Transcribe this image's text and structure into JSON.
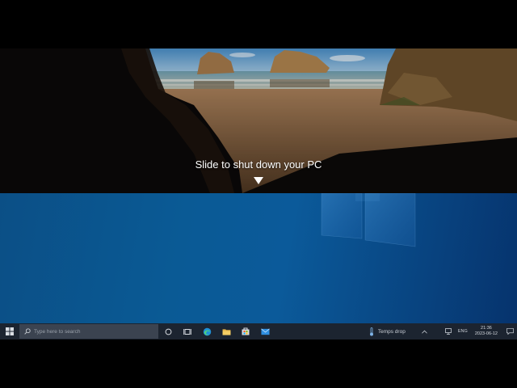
{
  "lock_screen": {
    "prompt": "Slide to shut down your PC"
  },
  "taskbar": {
    "search_placeholder": "Type here to search",
    "weather_text": "Temps drop",
    "language": "ENG",
    "clock_time": "21:36",
    "clock_date": "2023-06-12",
    "pinned": [
      {
        "name": "cortana-icon"
      },
      {
        "name": "task-view-icon"
      },
      {
        "name": "edge-icon"
      },
      {
        "name": "file-explorer-icon"
      },
      {
        "name": "store-icon"
      },
      {
        "name": "mail-icon"
      }
    ]
  },
  "colors": {
    "taskbar_bg": "#1c2430",
    "desktop_blue": "#0b5a9a",
    "accent": "#2f8fe0"
  }
}
